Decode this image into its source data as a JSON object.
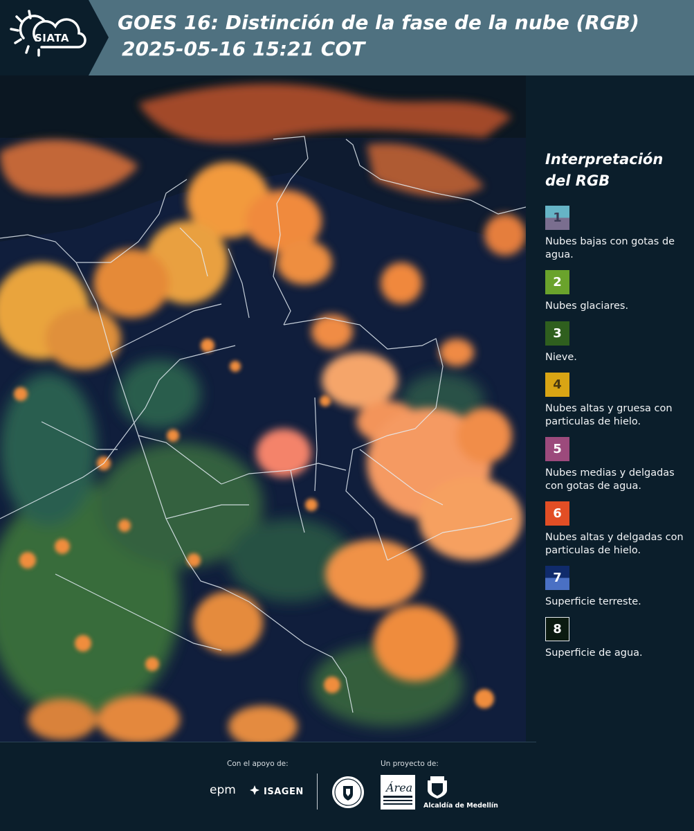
{
  "header": {
    "logo_text": "SIATA",
    "title_line1": "GOES 16: Distinción de la fase de la nube (RGB)",
    "title_line2": "2025-05-16 15:21 COT"
  },
  "legend": {
    "title_line1": "Interpretación",
    "title_line2": "del RGB",
    "items": [
      {
        "number": "1",
        "label": "Nubes bajas con gotas de agua.",
        "color_top": "#66b4c6",
        "color_bottom": "#7a6e8f"
      },
      {
        "number": "2",
        "label": "Nubes glaciares.",
        "color": "#6aa32c"
      },
      {
        "number": "3",
        "label": "Nieve.",
        "color": "#2f5f1e"
      },
      {
        "number": "4",
        "label": "Nubes altas y gruesa con particulas de hielo.",
        "color": "#d9a514"
      },
      {
        "number": "5",
        "label": "Nubes medias y delgadas con gotas de agua.",
        "color": "#9c4a7c"
      },
      {
        "number": "6",
        "label": "Nubes altas y delgadas con particulas de hielo.",
        "color": "#e24e25"
      },
      {
        "number": "7",
        "label": "Superficie terreste.",
        "color_top": "#102b6b",
        "color_bottom": "#4a70c4"
      },
      {
        "number": "8",
        "label": "Superficie de agua.",
        "color": "#0b1a10"
      }
    ]
  },
  "footer": {
    "support_label": "Con el apoyo de:",
    "project_label": "Un proyecto de:",
    "epm": "epm",
    "isagen": "ISAGEN",
    "alcaldia": "Alcaldía de Medellín",
    "area": "Área"
  }
}
